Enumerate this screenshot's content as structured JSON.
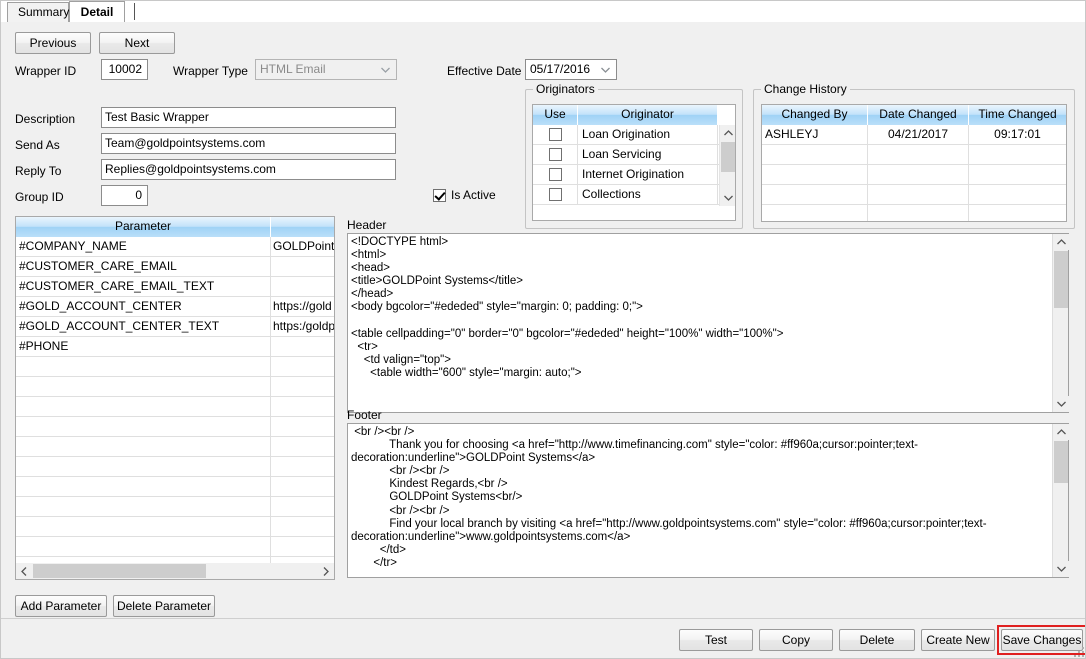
{
  "tabs": [
    {
      "label": "Summary",
      "selected": false
    },
    {
      "label": "Detail",
      "selected": true
    }
  ],
  "nav": {
    "previous_label": "Previous",
    "next_label": "Next"
  },
  "fields": {
    "wrapper_id_label": "Wrapper ID",
    "wrapper_id_value": "10002",
    "wrapper_type_label": "Wrapper Type",
    "wrapper_type_value": "HTML Email",
    "effective_date_label": "Effective Date",
    "effective_date_value": "05/17/2016",
    "description_label": "Description",
    "description_value": "Test Basic Wrapper",
    "send_as_label": "Send As",
    "send_as_value": "Team@goldpointsystems.com",
    "reply_to_label": "Reply To",
    "reply_to_value": "Replies@goldpointsystems.com",
    "group_id_label": "Group ID",
    "group_id_value": "0",
    "is_active_label": "Is Active",
    "is_active_checked": true
  },
  "originators": {
    "title": "Originators",
    "columns": [
      "Use",
      "Originator",
      ""
    ],
    "rows": [
      {
        "use": false,
        "name": "Loan Origination"
      },
      {
        "use": false,
        "name": "Loan Servicing"
      },
      {
        "use": false,
        "name": "Internet Origination"
      },
      {
        "use": false,
        "name": "Collections"
      }
    ]
  },
  "change_history": {
    "title": "Change History",
    "columns": [
      "Changed By",
      "Date Changed",
      "Time Changed"
    ],
    "rows": [
      {
        "changed_by": "ASHLEYJ",
        "date_changed": "04/21/2017",
        "time_changed": "09:17:01"
      },
      {
        "changed_by": "",
        "date_changed": "",
        "time_changed": ""
      },
      {
        "changed_by": "",
        "date_changed": "",
        "time_changed": ""
      },
      {
        "changed_by": "",
        "date_changed": "",
        "time_changed": ""
      },
      {
        "changed_by": "",
        "date_changed": "",
        "time_changed": ""
      },
      {
        "changed_by": "",
        "date_changed": "",
        "time_changed": ""
      }
    ]
  },
  "parameters": {
    "columns": [
      "Parameter",
      ""
    ],
    "rows": [
      {
        "parameter": "#COMPANY_NAME",
        "value": "GOLDPoint"
      },
      {
        "parameter": "#CUSTOMER_CARE_EMAIL",
        "value": ""
      },
      {
        "parameter": "#CUSTOMER_CARE_EMAIL_TEXT",
        "value": ""
      },
      {
        "parameter": "#GOLD_ACCOUNT_CENTER",
        "value": "https://gold"
      },
      {
        "parameter": "#GOLD_ACCOUNT_CENTER_TEXT",
        "value": "https:/goldp"
      },
      {
        "parameter": "#PHONE",
        "value": ""
      },
      {
        "parameter": "",
        "value": ""
      },
      {
        "parameter": "",
        "value": ""
      },
      {
        "parameter": "",
        "value": ""
      },
      {
        "parameter": "",
        "value": ""
      },
      {
        "parameter": "",
        "value": ""
      },
      {
        "parameter": "",
        "value": ""
      },
      {
        "parameter": "",
        "value": ""
      },
      {
        "parameter": "",
        "value": ""
      },
      {
        "parameter": "",
        "value": ""
      },
      {
        "parameter": "",
        "value": ""
      },
      {
        "parameter": "",
        "value": ""
      }
    ],
    "add_label": "Add Parameter",
    "delete_label": "Delete Parameter"
  },
  "header_section": {
    "label": "Header",
    "code": "<!DOCTYPE html>\n<html>\n<head>\n<title>GOLDPoint Systems</title>\n</head>\n<body bgcolor=\"#ededed\" style=\"margin: 0; padding: 0;\">\n\n<table cellpadding=\"0\" border=\"0\" bgcolor=\"#ededed\" height=\"100%\" width=\"100%\">\n  <tr>\n    <td valign=\"top\">\n      <table width=\"600\" style=\"margin: auto;\">"
  },
  "footer_section": {
    "label": "Footer",
    "code": " <br /><br />\n            Thank you for choosing <a href=\"http://www.timefinancing.com\" style=\"color: #ff960a;cursor:pointer;text-\ndecoration:underline\">GOLDPoint Systems</a>\n            <br /><br />\n            Kindest Regards,<br />\n            GOLDPoint Systems<br/>\n            <br /><br />\n            Find your local branch by visiting <a href=\"http://www.goldpointsystems.com\" style=\"color: #ff960a;cursor:pointer;text-\ndecoration:underline\">www.goldpointsystems.com</a>\n         </td>\n       </tr>"
  },
  "actions": {
    "test_label": "Test",
    "copy_label": "Copy",
    "delete_label": "Delete",
    "create_new_label": "Create New",
    "save_changes_label": "Save Changes"
  },
  "colors": {
    "highlight_box": "#e02020",
    "link_color": "#ff960a",
    "grid_header": "#a6d5f7"
  }
}
